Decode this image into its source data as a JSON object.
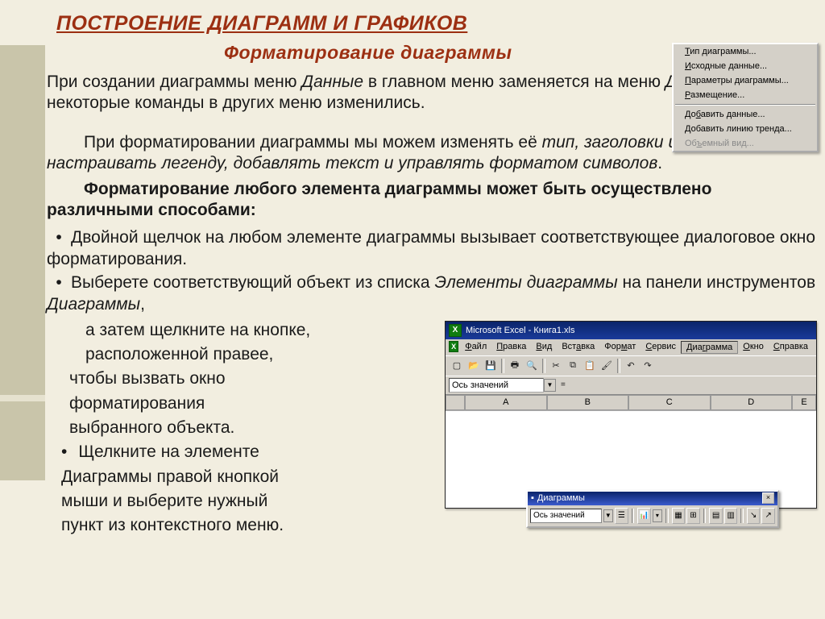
{
  "title": "ПОСТРОЕНИЕ  ДИАГРАММ И ГРАФИКОВ",
  "subtitle": "Форматирование диаграммы",
  "intro": {
    "p1a": "При создании диаграммы меню ",
    "p1b": "Данные",
    "p1c": " в главном меню заменяется на меню ",
    "p1d": "Диаграмма",
    "p1e": ", а некоторые команды в других меню изменились."
  },
  "body": {
    "p2a": "При форматировании диаграммы мы  можем изменять её ",
    "p2b": "тип, заголовки и линии сетки, настраивать легенду, добавлять текст и управлять форматом символов",
    "p2c": ".",
    "p3": "Форматирование любого элемента диаграммы может быть осуществлено различными способами:",
    "b1": "Двойной щелчок на любом элементе диаграммы вызывает соответствующее диалоговое окно форматирования.",
    "b2a": "Выберете соответствующий объект из списка ",
    "b2b": "Элементы диаграммы",
    "b2c": " на панели инструментов ",
    "b2d": "Диаграммы",
    "b2e": ","
  },
  "left": {
    "l1": "а затем щелкните на кнопке,",
    "l2": "расположенной правее,",
    "l3": "чтобы вызвать окно",
    "l4": "форматирования",
    "l5": "выбранного объекта.",
    "l6": "Щелкните на элементе",
    "l7": "Диаграммы правой кнопкой",
    "l8": "мыши и выберите нужный",
    "l9": "пункт из контекстного меню."
  },
  "excel": {
    "title": "Microsoft Excel - Книга1.xls",
    "menu": [
      "Файл",
      "Правка",
      "Вид",
      "Вставка",
      "Формат",
      "Сервис",
      "Диаграмма",
      "Окно",
      "Справка"
    ],
    "name_box": "Ось значений",
    "cols": [
      "A",
      "B",
      "C",
      "D",
      "E"
    ],
    "dropdown": {
      "i1": "Тип диаграммы...",
      "i2": "Исходные данные...",
      "i3": "Параметры диаграммы...",
      "i4": "Размещение...",
      "i5": "Добавить данные...",
      "i6": "Добавить линию тренда...",
      "i7": "Объемный вид..."
    },
    "float": {
      "title": "Диаграммы",
      "select": "Ось значений"
    }
  }
}
